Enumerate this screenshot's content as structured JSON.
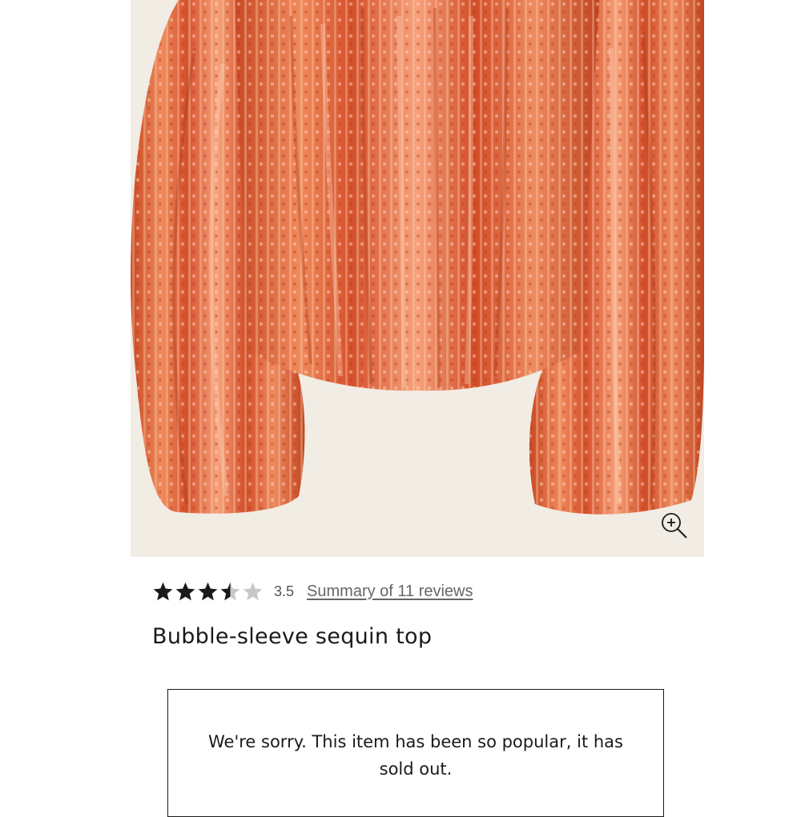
{
  "product": {
    "title": "Bubble-sleeve sequin top",
    "image_alt": "Orange sequin bubble-sleeve top",
    "rating": 3.5,
    "rating_label": "3.5",
    "max_rating": 5,
    "reviews_link": "Summary of 11 reviews"
  },
  "availability": {
    "message": "We're sorry. This item has been so popular, it has sold out."
  },
  "icons": {
    "zoom": "zoom-in-icon",
    "star": "star-icon"
  },
  "colors": {
    "sequin": "#d8532c",
    "sequin_highlight": "#f6b58f",
    "background": "#f1ece4",
    "star_filled": "#1a1a1a",
    "star_empty": "#c8c8c8"
  }
}
